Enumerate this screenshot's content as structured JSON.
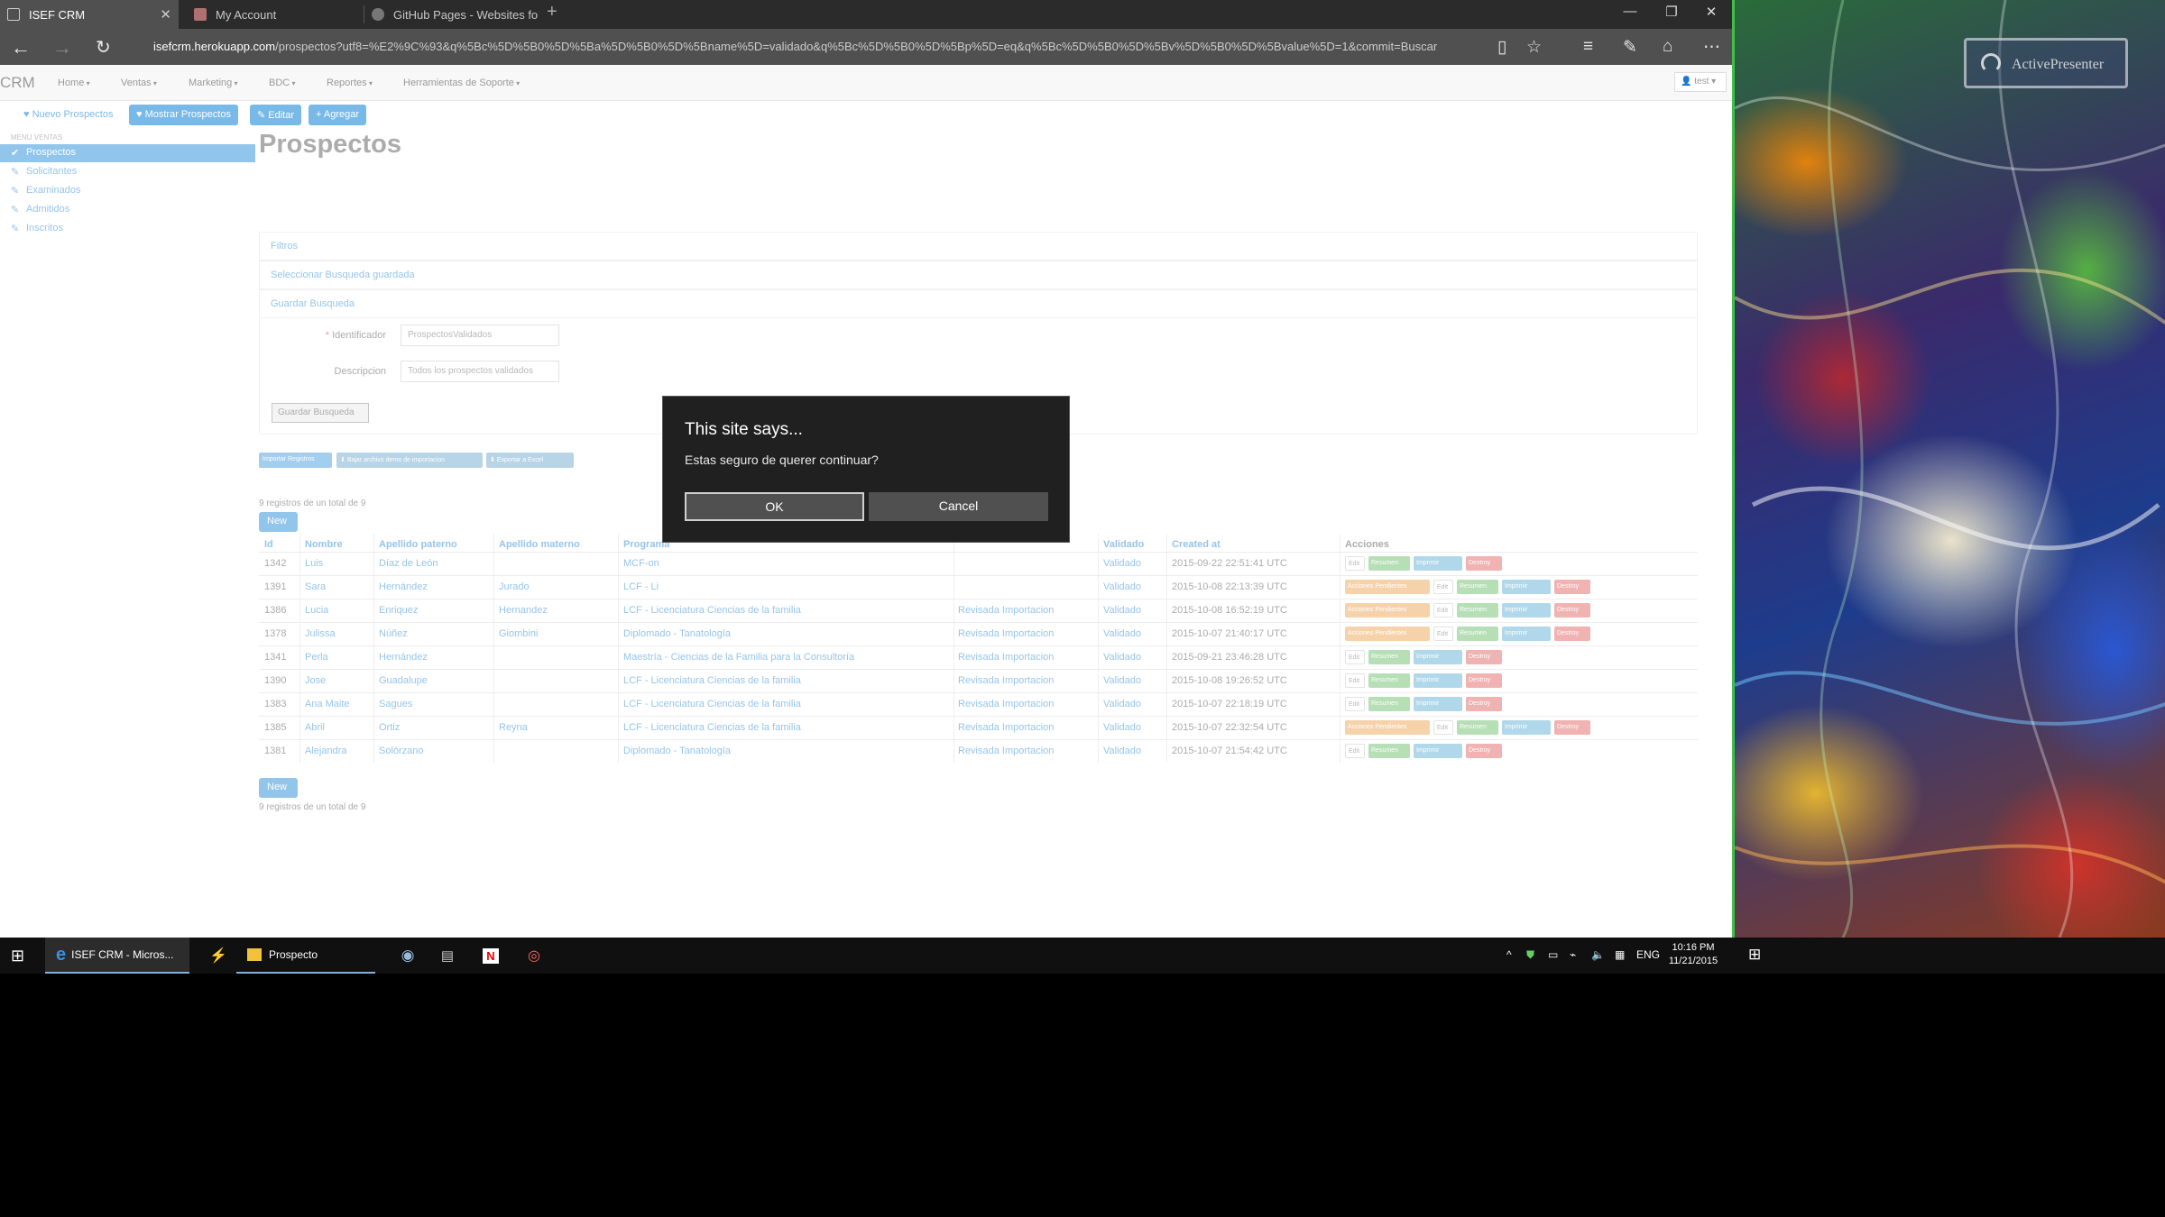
{
  "browser": {
    "tabs": [
      {
        "title": "ISEF CRM",
        "active": true
      },
      {
        "title": "My Account",
        "active": false
      },
      {
        "title": "GitHub Pages - Websites fo",
        "active": false
      }
    ],
    "url_host": "isefcrm.herokuapp.com",
    "url_path": "/prospectos?utf8=%E2%9C%93&q%5Bc%5D%5B0%5D%5Ba%5D%5B0%5D%5Bname%5D=validado&q%5Bc%5D%5B0%5D%5Bp%5D=eq&q%5Bc%5D%5B0%5D%5Bv%5D%5B0%5D%5Bvalue%5D=1&commit=Buscar"
  },
  "app": {
    "brand": "CRM",
    "menus": [
      "Home",
      "Ventas",
      "Marketing",
      "BDC",
      "Reportes",
      "Herramientas de Soporte"
    ],
    "user": "test",
    "actions": {
      "nuevo": "Nuevo Prospectos",
      "mostrar": "Mostrar Prospectos",
      "editar": "Editar",
      "agregar": "Agregar"
    },
    "sidebar": {
      "header": "MENU VENTAS",
      "items": [
        "Prospectos",
        "Solicitantes",
        "Examinados",
        "Admitidos",
        "Inscritos"
      ]
    }
  },
  "main": {
    "title": "Prospectos",
    "panels": {
      "filtros": "Filtros",
      "seleccionar": "Seleccionar Busqueda guardada",
      "guardar": "Guardar Busqueda"
    },
    "form": {
      "identificador_label": "Identificador",
      "identificador_value": "ProspectosValidados",
      "descripcion_label": "Descripcion",
      "descripcion_value": "Todos los prospectos validados",
      "submit": "Guardar Busqueda"
    },
    "import_buttons": [
      "Importar Registros",
      "Bajar archivo demo de importacion",
      "Exportar a Excel"
    ],
    "count_text": "9 registros de un total de 9",
    "new_label": "New"
  },
  "table": {
    "headers": [
      "Id",
      "Nombre",
      "Apellido paterno",
      "Apellido materno",
      "Programa",
      "",
      "Validado",
      "Created at",
      "Acciones"
    ],
    "rows": [
      {
        "id": "1342",
        "nombre": "Luis",
        "paterno": "Díaz de León",
        "materno": "",
        "programa": "MCF-on",
        "estado": "",
        "validado": "Validado",
        "created": "2015-09-22 22:51:41 UTC",
        "pendiente": false
      },
      {
        "id": "1391",
        "nombre": "Sara",
        "paterno": "Hernández",
        "materno": "Jurado",
        "programa": "LCF - Li",
        "estado": "",
        "validado": "Validado",
        "created": "2015-10-08 22:13:39 UTC",
        "pendiente": true
      },
      {
        "id": "1386",
        "nombre": "Lucia",
        "paterno": "Enriquez",
        "materno": "Hernandez",
        "programa": "LCF - Licenciatura Ciencias de la familia",
        "estado": "Revisada Importacion",
        "validado": "Validado",
        "created": "2015-10-08 16:52:19 UTC",
        "pendiente": true
      },
      {
        "id": "1378",
        "nombre": "Julissa",
        "paterno": "Núñez",
        "materno": "Giombini",
        "programa": "Diplomado - Tanatología",
        "estado": "Revisada Importacion",
        "validado": "Validado",
        "created": "2015-10-07 21:40:17 UTC",
        "pendiente": true
      },
      {
        "id": "1341",
        "nombre": "Perla",
        "paterno": "Hernández",
        "materno": "",
        "programa": "Maestría - Ciencias de la Familia para la Consultoría",
        "estado": "Revisada Importacion",
        "validado": "Validado",
        "created": "2015-09-21 23:46:28 UTC",
        "pendiente": false
      },
      {
        "id": "1390",
        "nombre": "Jose",
        "paterno": "Guadalupe",
        "materno": "",
        "programa": "LCF - Licenciatura Ciencias de la familia",
        "estado": "Revisada Importacion",
        "validado": "Validado",
        "created": "2015-10-08 19:26:52 UTC",
        "pendiente": false
      },
      {
        "id": "1383",
        "nombre": "Ana Maite",
        "paterno": "Sagues",
        "materno": "",
        "programa": "LCF - Licenciatura Ciencias de la familia",
        "estado": "Revisada Importacion",
        "validado": "Validado",
        "created": "2015-10-07 22:18:19 UTC",
        "pendiente": false
      },
      {
        "id": "1385",
        "nombre": "Abril",
        "paterno": "Ortiz",
        "materno": "Reyna",
        "programa": "LCF - Licenciatura Ciencias de la familia",
        "estado": "Revisada Importacion",
        "validado": "Validado",
        "created": "2015-10-07 22:32:54 UTC",
        "pendiente": true
      },
      {
        "id": "1381",
        "nombre": "Alejandra",
        "paterno": "Solórzano",
        "materno": "",
        "programa": "Diplomado - Tanatología",
        "estado": "Revisada Importacion",
        "validado": "Validado",
        "created": "2015-10-07 21:54:42 UTC",
        "pendiente": false
      }
    ],
    "row_actions": {
      "pendiente": "Acciones Pendientes",
      "edit": "Edit",
      "resumen": "Resumen",
      "imprimir": "Imprimir",
      "destroy": "Destroy"
    }
  },
  "dialog": {
    "title": "This site says...",
    "message": "Estas seguro de querer continuar?",
    "ok": "OK",
    "cancel": "Cancel"
  },
  "desktop": {
    "watermark": "ActivePresenter"
  },
  "taskbar": {
    "items": [
      "ISEF CRM - Micros...",
      "Prospecto"
    ],
    "lang": "ENG",
    "time": "10:16 PM",
    "date": "11/21/2015"
  }
}
